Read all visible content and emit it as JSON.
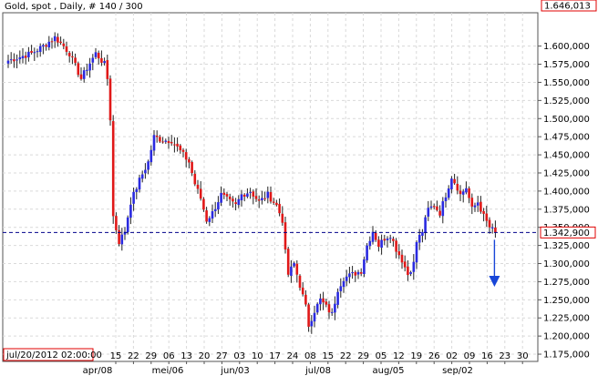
{
  "header": {
    "title": "Gold, spot , Daily, # 140 / 300"
  },
  "price_scale": {
    "top_value_label": "1.646,013",
    "current_value_label": "1.342,900"
  },
  "time_cursor": {
    "label": "jul/20/2012 02:00:00"
  },
  "colors": {
    "up": "#2a2ae0",
    "down": "#e01818",
    "wick": "#222222",
    "current_line": "#00008b",
    "arrow": "#1846d8",
    "label_red": "#e00000",
    "label_blue": "#0000c0",
    "grid": "#d9d9d9"
  },
  "chart_data": {
    "type": "candlestick",
    "ylim": [
      1165000,
      1646013
    ],
    "yticks": [
      1175000,
      1200000,
      1225000,
      1250000,
      1275000,
      1300000,
      1325000,
      1350000,
      1375000,
      1400000,
      1425000,
      1450000,
      1475000,
      1500000,
      1525000,
      1550000,
      1575000,
      1600000
    ],
    "ytick_labels": [
      "1.175,000",
      "1.200,000",
      "1.225,000",
      "1.250,000",
      "1.275,000",
      "1.300,000",
      "1.325,000",
      "1.350,000",
      "1.375,000",
      "1.400,000",
      "1.425,000",
      "1.450,000",
      "1.475,000",
      "1.500,000",
      "1.525,000",
      "1.550,000",
      "1.575,000",
      "1.600,000"
    ],
    "xtick_labels": [
      "15",
      "22",
      "29",
      "06",
      "13",
      "20",
      "27",
      "03",
      "10",
      "17",
      "24",
      "08",
      "15",
      "22",
      "29",
      "05",
      "12",
      "19",
      "26",
      "02",
      "09",
      "16",
      "23",
      "30"
    ],
    "xmonth_labels": [
      "apr/08",
      "mei/06",
      "jun/03",
      "jul/08",
      "aug/05",
      "sep/02"
    ],
    "current_price": 1342900,
    "forecast": "down",
    "anchors": [
      [
        0,
        1580000
      ],
      [
        8,
        1590000
      ],
      [
        12,
        1600000
      ],
      [
        16,
        1612000
      ],
      [
        19,
        1600000
      ],
      [
        21,
        1590000
      ],
      [
        25,
        1555000
      ],
      [
        27,
        1570000
      ],
      [
        30,
        1590000
      ],
      [
        33,
        1575000
      ],
      [
        34,
        1555000
      ],
      [
        35,
        1500000
      ],
      [
        36,
        1365000
      ],
      [
        38,
        1330000
      ],
      [
        40,
        1345000
      ],
      [
        42,
        1385000
      ],
      [
        45,
        1415000
      ],
      [
        48,
        1440000
      ],
      [
        50,
        1475000
      ],
      [
        53,
        1470000
      ],
      [
        56,
        1470000
      ],
      [
        59,
        1455000
      ],
      [
        62,
        1440000
      ],
      [
        64,
        1410000
      ],
      [
        66,
        1390000
      ],
      [
        68,
        1360000
      ],
      [
        70,
        1370000
      ],
      [
        73,
        1395000
      ],
      [
        76,
        1385000
      ],
      [
        78,
        1380000
      ],
      [
        80,
        1395000
      ],
      [
        83,
        1400000
      ],
      [
        86,
        1385000
      ],
      [
        89,
        1395000
      ],
      [
        92,
        1380000
      ],
      [
        94,
        1360000
      ],
      [
        95,
        1315000
      ],
      [
        96,
        1285000
      ],
      [
        98,
        1300000
      ],
      [
        100,
        1270000
      ],
      [
        102,
        1240000
      ],
      [
        103,
        1215000
      ],
      [
        105,
        1235000
      ],
      [
        107,
        1250000
      ],
      [
        109,
        1240000
      ],
      [
        111,
        1230000
      ],
      [
        113,
        1265000
      ],
      [
        115,
        1280000
      ],
      [
        118,
        1285000
      ],
      [
        121,
        1290000
      ],
      [
        123,
        1325000
      ],
      [
        125,
        1345000
      ],
      [
        127,
        1325000
      ],
      [
        129,
        1335000
      ],
      [
        131,
        1340000
      ],
      [
        133,
        1320000
      ],
      [
        135,
        1305000
      ],
      [
        137,
        1285000
      ],
      [
        139,
        1300000
      ],
      [
        140,
        1330000
      ],
      [
        142,
        1345000
      ],
      [
        144,
        1375000
      ],
      [
        146,
        1380000
      ],
      [
        148,
        1370000
      ],
      [
        150,
        1395000
      ],
      [
        152,
        1420000
      ],
      [
        154,
        1405000
      ],
      [
        155,
        1395000
      ],
      [
        157,
        1405000
      ],
      [
        159,
        1375000
      ],
      [
        161,
        1385000
      ],
      [
        163,
        1365000
      ],
      [
        165,
        1350000
      ],
      [
        167,
        1342900
      ]
    ]
  }
}
